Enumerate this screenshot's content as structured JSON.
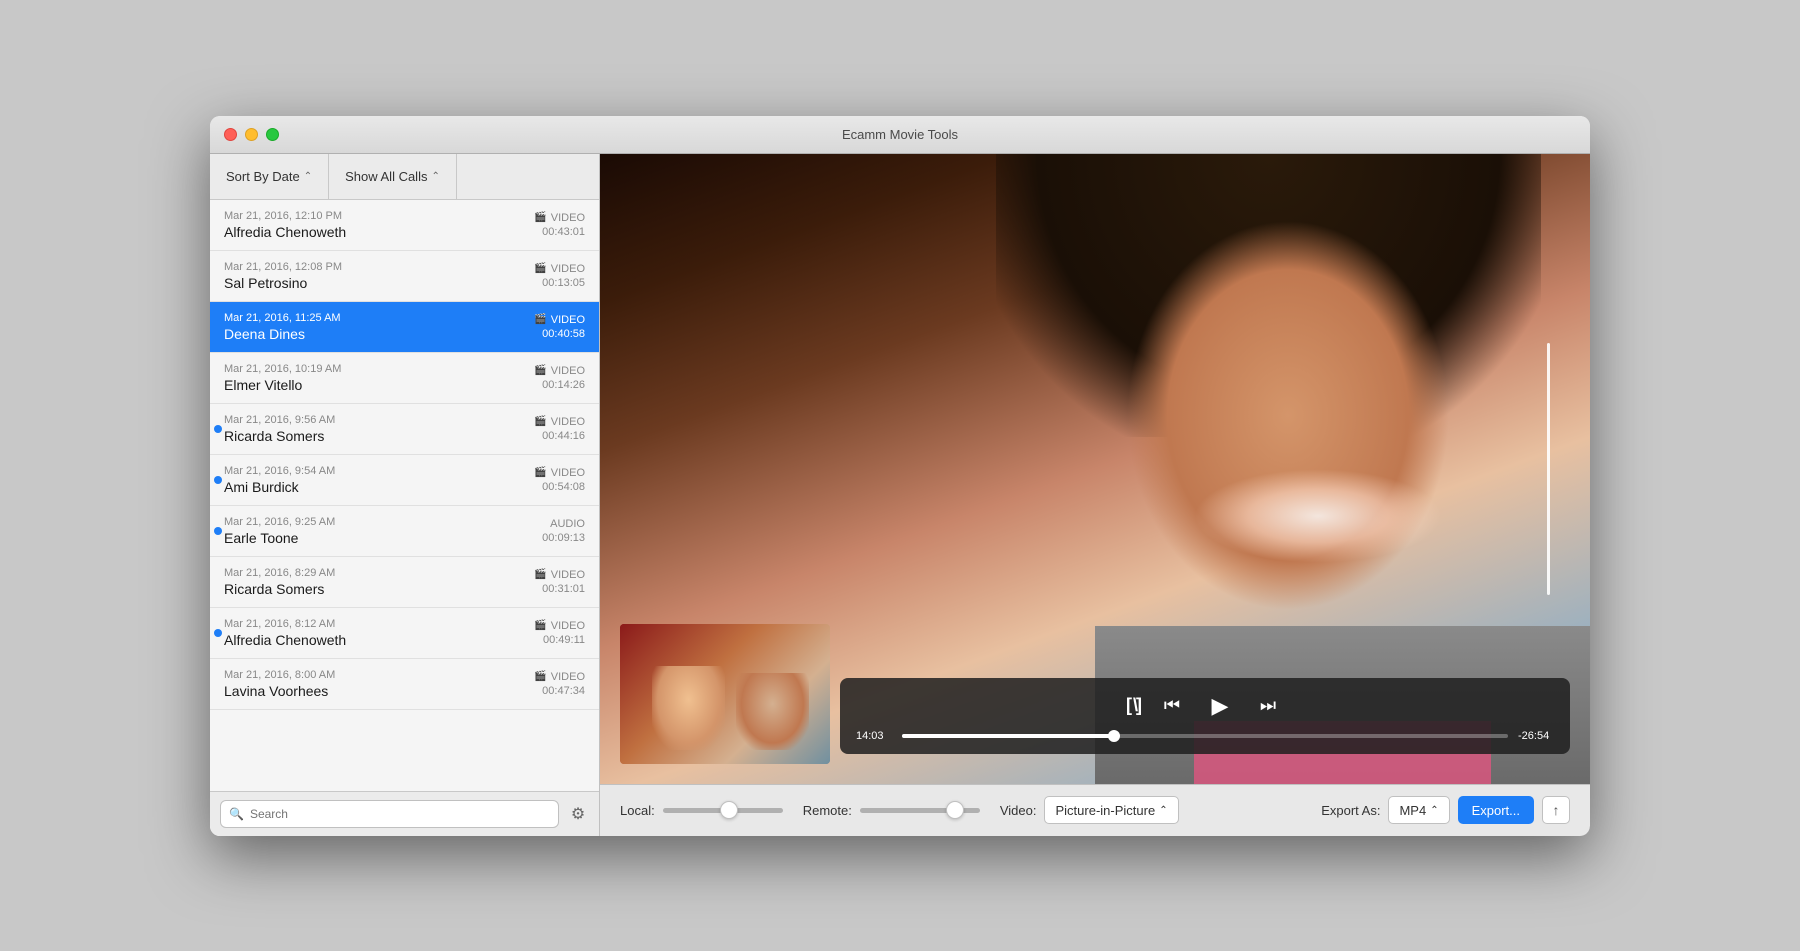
{
  "window": {
    "title": "Ecamm Movie Tools"
  },
  "sidebar": {
    "sort_btn": "Sort By Date",
    "show_btn": "Show All Calls",
    "search_placeholder": "Search",
    "calls": [
      {
        "id": 1,
        "date": "Mar 21, 2016, 12:10 PM",
        "name": "Alfredia Chenoweth",
        "type": "VIDEO",
        "duration": "00:43:01",
        "unread": false,
        "selected": false
      },
      {
        "id": 2,
        "date": "Mar 21, 2016, 12:08 PM",
        "name": "Sal Petrosino",
        "type": "VIDEO",
        "duration": "00:13:05",
        "unread": false,
        "selected": false
      },
      {
        "id": 3,
        "date": "Mar 21, 2016, 11:25 AM",
        "name": "Deena Dines",
        "type": "VIDEO",
        "duration": "00:40:58",
        "unread": false,
        "selected": true
      },
      {
        "id": 4,
        "date": "Mar 21, 2016, 10:19 AM",
        "name": "Elmer Vitello",
        "type": "VIDEO",
        "duration": "00:14:26",
        "unread": false,
        "selected": false
      },
      {
        "id": 5,
        "date": "Mar 21, 2016, 9:56 AM",
        "name": "Ricarda Somers",
        "type": "VIDEO",
        "duration": "00:44:16",
        "unread": true,
        "selected": false
      },
      {
        "id": 6,
        "date": "Mar 21, 2016, 9:54 AM",
        "name": "Ami Burdick",
        "type": "VIDEO",
        "duration": "00:54:08",
        "unread": true,
        "selected": false
      },
      {
        "id": 7,
        "date": "Mar 21, 2016, 9:25 AM",
        "name": "Earle Toone",
        "type": "AUDIO",
        "duration": "00:09:13",
        "unread": true,
        "selected": false
      },
      {
        "id": 8,
        "date": "Mar 21, 2016, 8:29 AM",
        "name": "Ricarda Somers",
        "type": "VIDEO",
        "duration": "00:31:01",
        "unread": false,
        "selected": false
      },
      {
        "id": 9,
        "date": "Mar 21, 2016, 8:12 AM",
        "name": "Alfredia Chenoweth",
        "type": "VIDEO",
        "duration": "00:49:11",
        "unread": true,
        "selected": false
      },
      {
        "id": 10,
        "date": "Mar 21, 2016, 8:00 AM",
        "name": "Lavina Voorhees",
        "type": "VIDEO",
        "duration": "00:47:34",
        "unread": false,
        "selected": false
      }
    ]
  },
  "player": {
    "current_time": "14:03",
    "remaining_time": "-26:54",
    "clip_icon": "[\\ ]",
    "rewind_icon": "⏮",
    "play_icon": "▶",
    "forward_icon": "⏭",
    "progress_percent": 35
  },
  "bottom_bar": {
    "local_label": "Local:",
    "remote_label": "Remote:",
    "video_label": "Video:",
    "video_option": "Picture-in-Picture",
    "export_label": "Export As:",
    "export_format": "MP4",
    "export_btn": "Export...",
    "share_icon": "↑"
  }
}
